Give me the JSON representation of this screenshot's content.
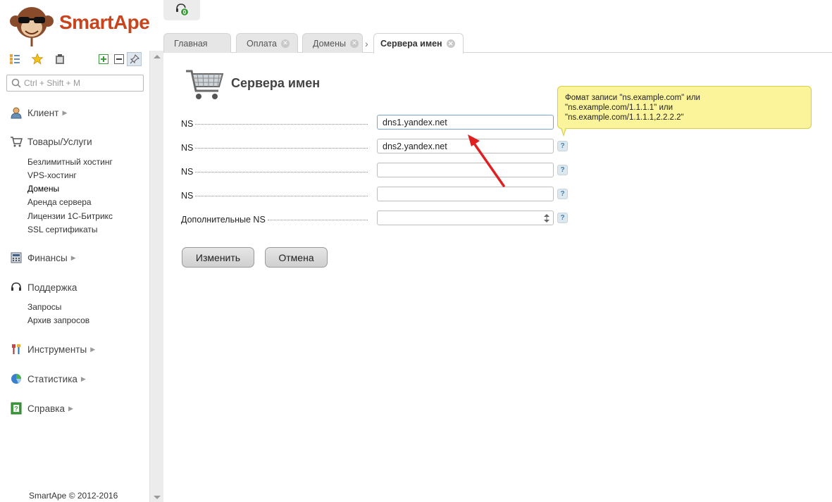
{
  "brand": {
    "name": "SmartApe",
    "accent": "#c8441c"
  },
  "search": {
    "placeholder": "Ctrl + Shift + M"
  },
  "topbar": {
    "support_badge": "0"
  },
  "sidebar": {
    "sections": [
      {
        "label": "Клиент",
        "icon": "user-icon"
      },
      {
        "label": "Товары/Услуги",
        "icon": "cart-icon",
        "items": [
          "Безлимитный хостинг",
          "VPS-хостинг",
          "Домены",
          "Аренда сервера",
          "Лицензии 1С-Битрикс",
          "SSL сертификаты"
        ]
      },
      {
        "label": "Финансы",
        "icon": "finance-icon"
      },
      {
        "label": "Поддержка",
        "icon": "headset-icon",
        "items": [
          "Запросы",
          "Архив запросов"
        ]
      },
      {
        "label": "Инструменты",
        "icon": "tools-icon"
      },
      {
        "label": "Статистика",
        "icon": "pie-chart-icon"
      },
      {
        "label": "Справка",
        "icon": "help-book-icon"
      }
    ],
    "footer": "SmartApe © 2012-2016"
  },
  "tabs": [
    "Главная",
    "Оплата",
    "Домены",
    "Сервера имен"
  ],
  "page": {
    "title": "Сервера имен",
    "fields": [
      {
        "label": "NS",
        "value": "dns1.yandex.net"
      },
      {
        "label": "NS",
        "value": "dns2.yandex.net"
      },
      {
        "label": "NS",
        "value": ""
      },
      {
        "label": "NS",
        "value": ""
      },
      {
        "label": "Дополнительные NS",
        "value": ""
      }
    ],
    "tooltip": [
      "Фомат записи \"ns.example.com\" или",
      "\"ns.example.com/1.1.1.1\" или",
      "\"ns.example.com/1.1.1.1,2.2.2.2\""
    ],
    "help_glyph": "?",
    "buttons": {
      "submit": "Изменить",
      "cancel": "Отмена"
    }
  }
}
